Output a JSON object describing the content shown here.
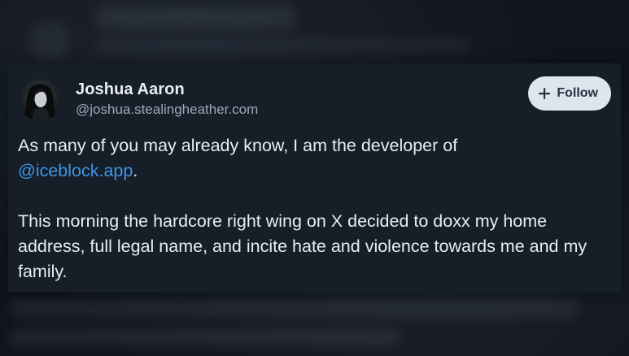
{
  "post": {
    "author": {
      "display_name": "Joshua Aaron",
      "handle": "@joshua.stealingheather.com"
    },
    "follow_button": {
      "label": "Follow",
      "icon": "plus-icon"
    },
    "text": {
      "line1_prefix": "As many of you may already know, I am the developer of",
      "mention": "@iceblock.app",
      "line1_suffix": ".",
      "paragraph2": "This morning the hardcore right wing on X decided to doxx my home address, full legal name, and incite hate and violence towards me and my family."
    }
  },
  "colors": {
    "card_background": "#161e27",
    "mention": "#3e95e8",
    "follow_button_bg": "#dfe5ec"
  }
}
